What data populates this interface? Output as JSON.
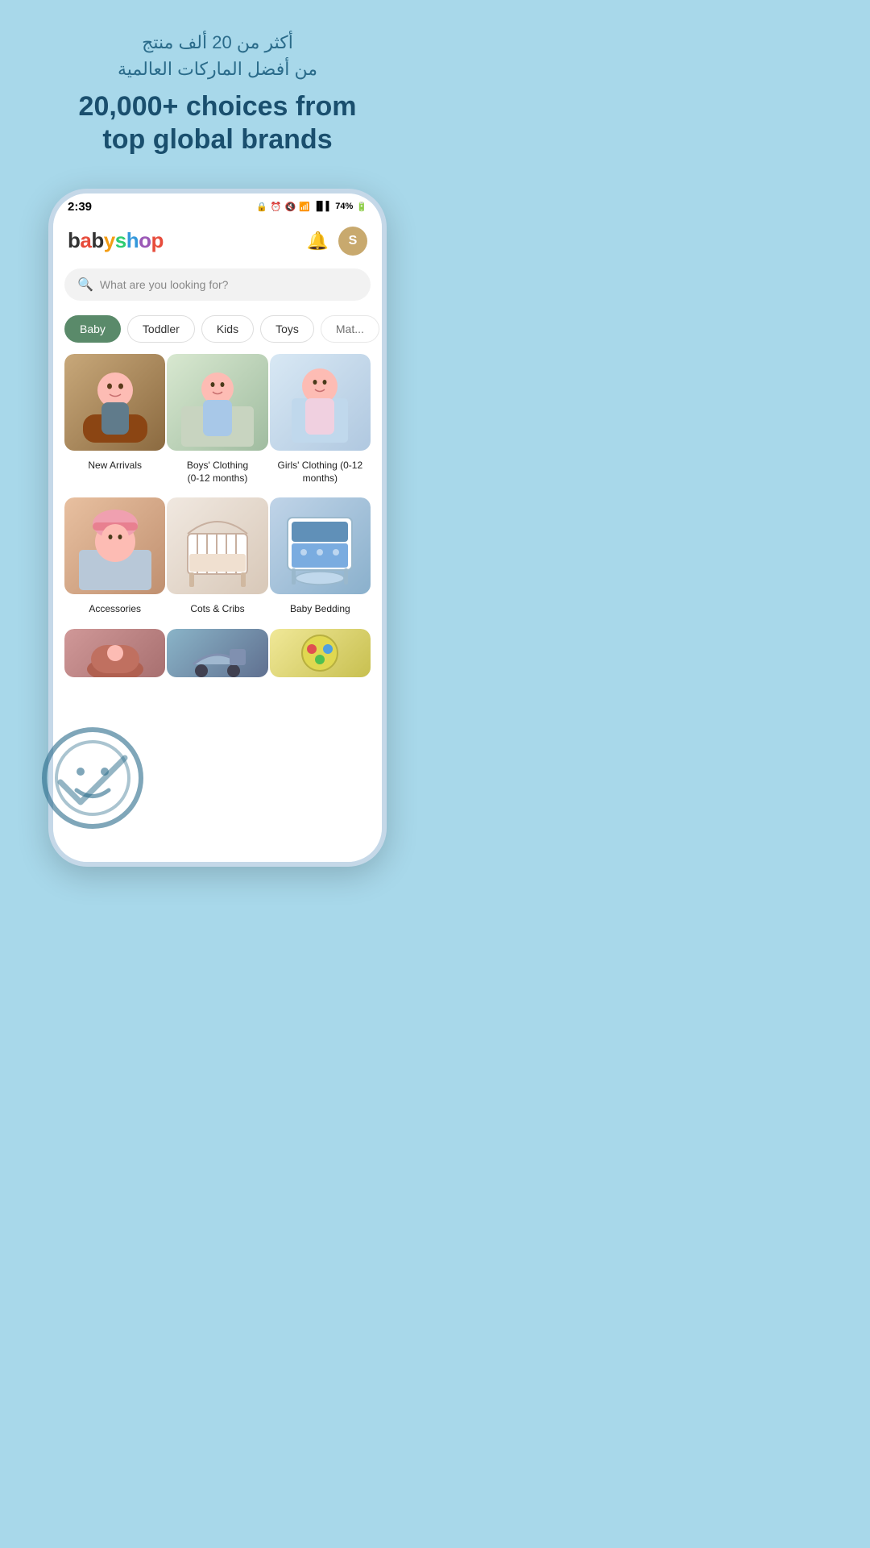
{
  "banner": {
    "arabic_text": "أكثر من 20 ألف منتج\nمن أفضل الماركات العالمية",
    "english_line1": "20,000+ choices from",
    "english_line2": "top global brands"
  },
  "status_bar": {
    "time": "2:39",
    "battery": "74%",
    "icons": "🔒 ⏰ 🔇 📶"
  },
  "header": {
    "logo": "babyshop",
    "logo_colors": "multi",
    "bell_label": "🔔",
    "avatar_label": "S"
  },
  "search": {
    "placeholder": "What are you looking for?"
  },
  "categories": [
    {
      "id": "baby",
      "label": "Baby",
      "active": true
    },
    {
      "id": "toddler",
      "label": "Toddler",
      "active": false
    },
    {
      "id": "kids",
      "label": "Kids",
      "active": false
    },
    {
      "id": "toys",
      "label": "Toys",
      "active": false
    },
    {
      "id": "maternity",
      "label": "Mat...",
      "active": false
    }
  ],
  "products": [
    {
      "id": "new-arrivals",
      "label": "New Arrivals",
      "bg": "#d4b896",
      "emoji": "👶"
    },
    {
      "id": "boys-clothing",
      "label": "Boys' Clothing\n(0-12 months)",
      "bg": "#b8cdb8",
      "emoji": "👦"
    },
    {
      "id": "girls-clothing",
      "label": "Girls' Clothing (0-12\nmonths)",
      "bg": "#c8dce8",
      "emoji": "👧"
    },
    {
      "id": "accessories",
      "label": "Accessories",
      "bg": "#e0b8a0",
      "emoji": "🎩"
    },
    {
      "id": "cots-cribs",
      "label": "Cots & Cribs",
      "bg": "#ede0d8",
      "emoji": "🛏"
    },
    {
      "id": "baby-bedding",
      "label": "Baby Bedding",
      "bg": "#b8d0e8",
      "emoji": "🛌"
    },
    {
      "id": "row3-1",
      "label": "",
      "bg": "#c8a0a0",
      "emoji": "🚗"
    },
    {
      "id": "row3-2",
      "label": "",
      "bg": "#90b8c8",
      "emoji": "🛒"
    },
    {
      "id": "row3-3",
      "label": "",
      "bg": "#e8e0a0",
      "emoji": "🎠"
    }
  ],
  "colors": {
    "background": "#a8d8ea",
    "phone_border": "#c5d8e8",
    "active_tab": "#5a8a6a",
    "accent_blue": "#3498db",
    "arabic_text_color": "#2a6b8a",
    "heading_color": "#1a4f6e"
  }
}
